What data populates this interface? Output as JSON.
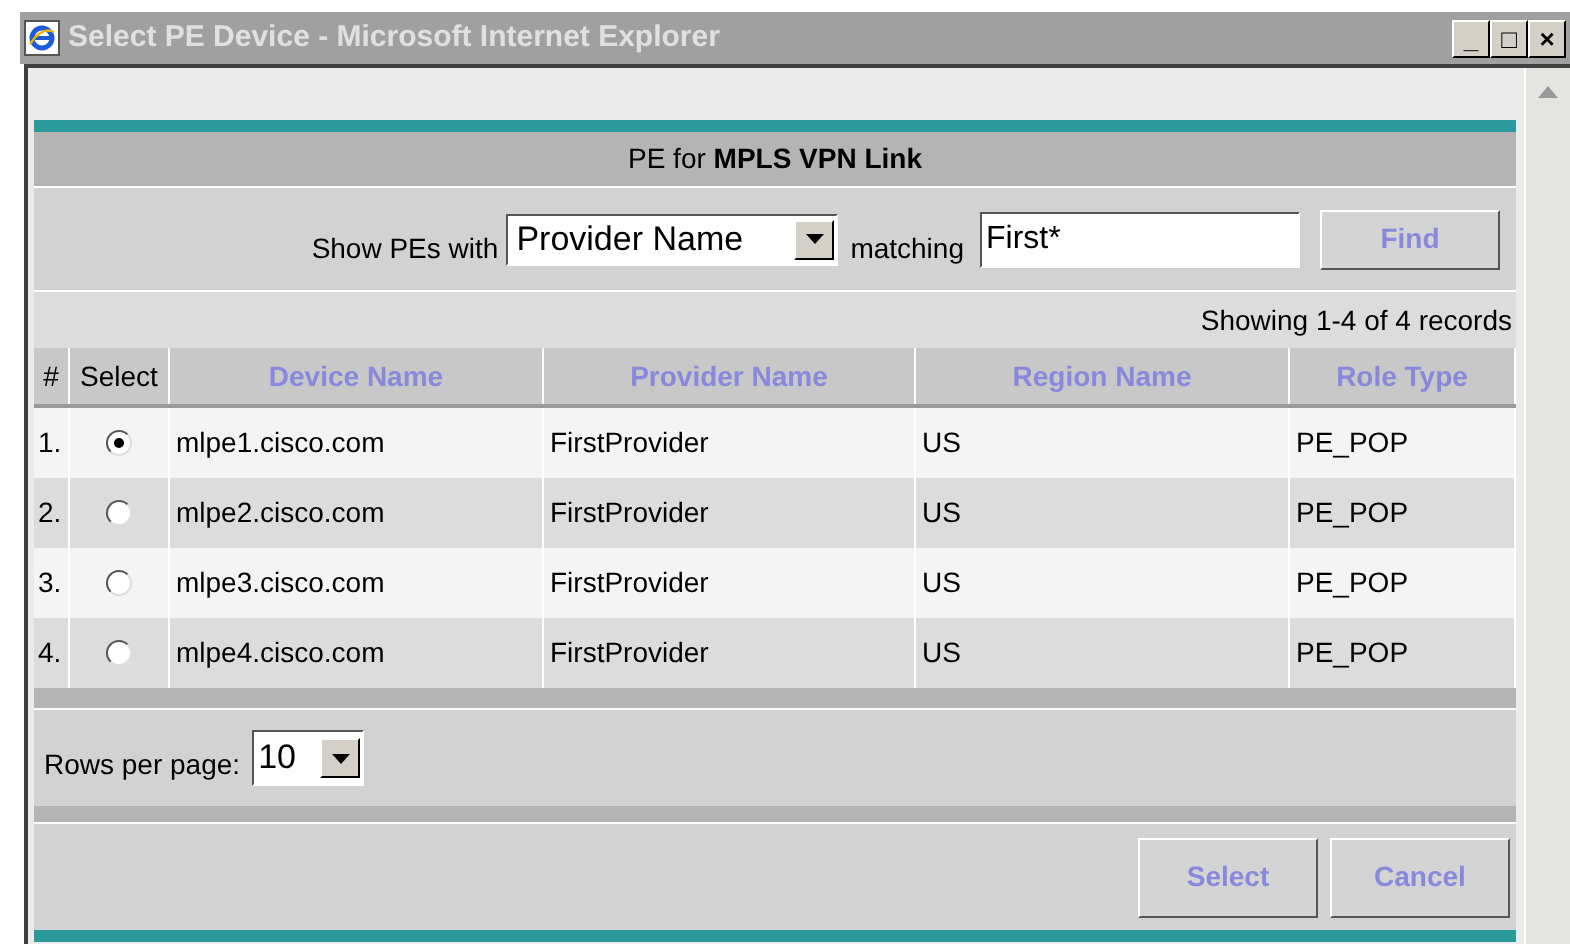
{
  "window": {
    "title": "Select PE Device - Microsoft Internet Explorer",
    "controls": [
      "_",
      "□",
      "×"
    ]
  },
  "panel": {
    "heading_prefix": "PE for ",
    "heading_bold": "MPLS VPN Link"
  },
  "search": {
    "label": "Show PEs with",
    "field": "Provider Name",
    "matching_label": "matching",
    "value": "First*",
    "find_button": "Find"
  },
  "status": "Showing 1-4 of 4 records",
  "table": {
    "columns": [
      "#",
      "Select",
      "Device Name",
      "Provider Name",
      "Region Name",
      "Role Type"
    ],
    "rows": [
      {
        "number": "1.",
        "selected": true,
        "device": "mlpe1.cisco.com",
        "provider": "FirstProvider",
        "region": "US",
        "role": "PE_POP"
      },
      {
        "number": "2.",
        "selected": false,
        "device": "mlpe2.cisco.com",
        "provider": "FirstProvider",
        "region": "US",
        "role": "PE_POP"
      },
      {
        "number": "3.",
        "selected": false,
        "device": "mlpe3.cisco.com",
        "provider": "FirstProvider",
        "region": "US",
        "role": "PE_POP"
      },
      {
        "number": "4.",
        "selected": false,
        "device": "mlpe4.cisco.com",
        "provider": "FirstProvider",
        "region": "US",
        "role": "PE_POP"
      }
    ]
  },
  "pagination": {
    "label": "Rows per page:",
    "value": "10"
  },
  "buttons": [
    "Select",
    "Cancel"
  ]
}
